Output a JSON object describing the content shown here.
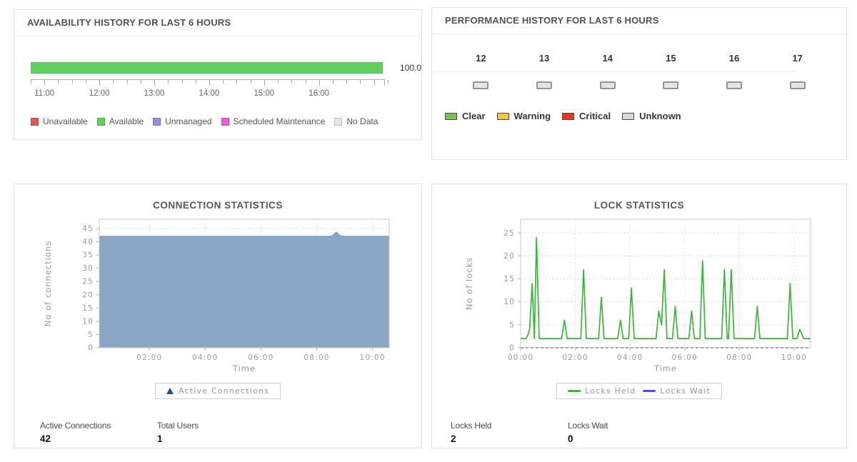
{
  "panels": {
    "availability": {
      "title": "AVAILABILITY HISTORY FOR LAST 6 HOURS",
      "bar_value_label": "100.0",
      "bar_color": "#5ed05e",
      "axis_labels": [
        "11:00",
        "12:00",
        "13:00",
        "14:00",
        "15:00",
        "16:00"
      ],
      "legend": [
        {
          "label": "Unavailable",
          "color": "#e25856"
        },
        {
          "label": "Available",
          "color": "#5ed05e"
        },
        {
          "label": "Unmanaged",
          "color": "#928ee0"
        },
        {
          "label": "Scheduled Maintenance",
          "color": "#df63df"
        },
        {
          "label": "No Data",
          "color": "#e4e4e4"
        }
      ]
    },
    "performance": {
      "title": "PERFORMANCE HISTORY FOR LAST 6 HOURS",
      "hours": [
        "12",
        "13",
        "14",
        "15",
        "16",
        "17"
      ],
      "hour_status_color": "#e4e4e4",
      "legend": [
        {
          "label": "Clear",
          "color": "#78c14f"
        },
        {
          "label": "Warning",
          "color": "#f3c73f"
        },
        {
          "label": "Critical",
          "color": "#e53a1b"
        },
        {
          "label": "Unknown",
          "color": "#d9d9d9"
        }
      ]
    },
    "connections": {
      "legend": [
        {
          "label": "Active Connections",
          "marker": "triangle",
          "color": "#1d4f8f"
        }
      ],
      "stats": [
        {
          "label": "Active Connections",
          "value": "42"
        },
        {
          "label": "Total Users",
          "value": "1"
        }
      ]
    },
    "locks": {
      "legend": [
        {
          "label": "Locks Held",
          "marker": "line",
          "color": "#3bb53b"
        },
        {
          "label": "Locks Wait",
          "marker": "line",
          "color": "#5153cf"
        }
      ],
      "stats": [
        {
          "label": "Locks Held",
          "value": "2"
        },
        {
          "label": "Locks Wait",
          "value": "0"
        }
      ]
    }
  },
  "chart_data": [
    {
      "id": "connections",
      "type": "area",
      "title": "CONNECTION STATISTICS",
      "xlabel": "Time",
      "ylabel": "No of connections",
      "x_range": [
        0.2,
        10.6
      ],
      "y_range": [
        0,
        48.5
      ],
      "yticks": [
        0,
        5,
        10,
        15,
        20,
        25,
        30,
        35,
        40,
        45
      ],
      "xticks": [
        {
          "t": 2,
          "label": "02:00"
        },
        {
          "t": 4,
          "label": "04:00"
        },
        {
          "t": 6,
          "label": "06:00"
        },
        {
          "t": 8,
          "label": "08:00"
        },
        {
          "t": 10,
          "label": "10:00"
        }
      ],
      "grid": true,
      "legend_position": "bottom",
      "series": [
        {
          "name": "Active Connections",
          "color": "#8ba7c8",
          "stroke": "#7e9dc0",
          "fill": true,
          "points": [
            [
              0.2,
              42
            ],
            [
              8.4,
              42
            ],
            [
              8.55,
              42.2
            ],
            [
              8.7,
              43.6
            ],
            [
              8.85,
              42.2
            ],
            [
              9.0,
              42
            ],
            [
              10.6,
              42
            ]
          ]
        }
      ]
    },
    {
      "id": "locks",
      "type": "line",
      "title": "LOCK STATISTICS",
      "xlabel": "Time",
      "ylabel": "No of locks",
      "x_range": [
        0,
        10.6
      ],
      "y_range": [
        0,
        28
      ],
      "yticks": [
        0,
        5,
        10,
        15,
        20,
        25
      ],
      "xticks": [
        {
          "t": 0,
          "label": "00:00"
        },
        {
          "t": 2,
          "label": "02:00"
        },
        {
          "t": 4,
          "label": "04:00"
        },
        {
          "t": 6,
          "label": "06:00"
        },
        {
          "t": 8,
          "label": "08:00"
        },
        {
          "t": 10,
          "label": "10:00"
        }
      ],
      "grid": true,
      "legend_position": "bottom",
      "series": [
        {
          "name": "Locks Held",
          "color": "#3bb53b",
          "points": [
            [
              0,
              2
            ],
            [
              0.2,
              2
            ],
            [
              0.28,
              3
            ],
            [
              0.33,
              4
            ],
            [
              0.42,
              14
            ],
            [
              0.5,
              2
            ],
            [
              0.58,
              24
            ],
            [
              0.68,
              2
            ],
            [
              1.5,
              2
            ],
            [
              1.6,
              6
            ],
            [
              1.7,
              2
            ],
            [
              2.2,
              2
            ],
            [
              2.3,
              17
            ],
            [
              2.4,
              2
            ],
            [
              2.85,
              2
            ],
            [
              2.95,
              11
            ],
            [
              3.05,
              2
            ],
            [
              3.55,
              2
            ],
            [
              3.65,
              6
            ],
            [
              3.75,
              2
            ],
            [
              3.95,
              2
            ],
            [
              4.05,
              13
            ],
            [
              4.15,
              2
            ],
            [
              4.95,
              2
            ],
            [
              5.05,
              8
            ],
            [
              5.15,
              5
            ],
            [
              5.25,
              17
            ],
            [
              5.35,
              2
            ],
            [
              5.55,
              2
            ],
            [
              5.65,
              9
            ],
            [
              5.75,
              2
            ],
            [
              6.15,
              2
            ],
            [
              6.25,
              8
            ],
            [
              6.35,
              2
            ],
            [
              6.55,
              2
            ],
            [
              6.65,
              19
            ],
            [
              6.75,
              2
            ],
            [
              7.35,
              2
            ],
            [
              7.45,
              17
            ],
            [
              7.55,
              2
            ],
            [
              7.6,
              2
            ],
            [
              7.7,
              17
            ],
            [
              7.8,
              2
            ],
            [
              8.55,
              2
            ],
            [
              8.65,
              9
            ],
            [
              8.75,
              2
            ],
            [
              9.75,
              2
            ],
            [
              9.85,
              14
            ],
            [
              9.95,
              2
            ],
            [
              10.1,
              2
            ],
            [
              10.2,
              4
            ],
            [
              10.35,
              2
            ],
            [
              10.6,
              2
            ]
          ]
        },
        {
          "name": "Locks Wait",
          "color": "#5153cf",
          "dashed": true,
          "points": [
            [
              0,
              0
            ],
            [
              10.6,
              0
            ]
          ]
        }
      ]
    }
  ]
}
